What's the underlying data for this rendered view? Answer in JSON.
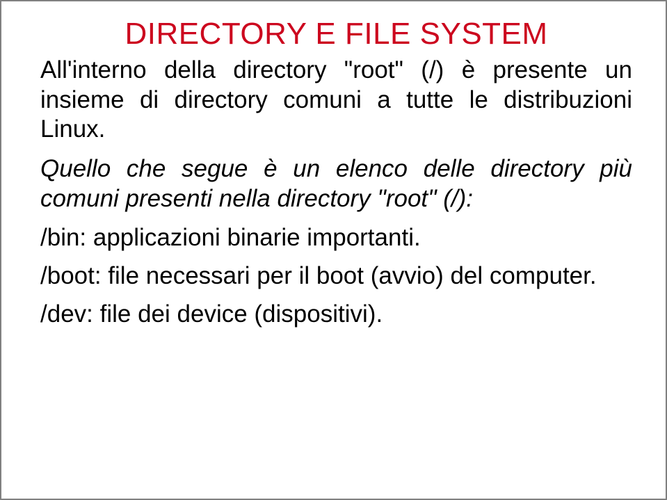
{
  "title": "DIRECTORY E FILE SYSTEM",
  "intro": "All'interno della directory \"root\" (/) è presente un insieme di directory comuni a tutte le distribuzioni Linux.",
  "subnote": "Quello che segue è un elenco delle directory più comuni presenti nella directory \"root\" (/):",
  "entries": [
    {
      "path": "/bin:",
      "desc": " applicazioni binarie importanti."
    },
    {
      "path": "/boot:",
      "desc": " file necessari per il boot (avvio) del computer."
    },
    {
      "path": "/dev:",
      "desc": " file dei device (dispositivi)."
    }
  ]
}
